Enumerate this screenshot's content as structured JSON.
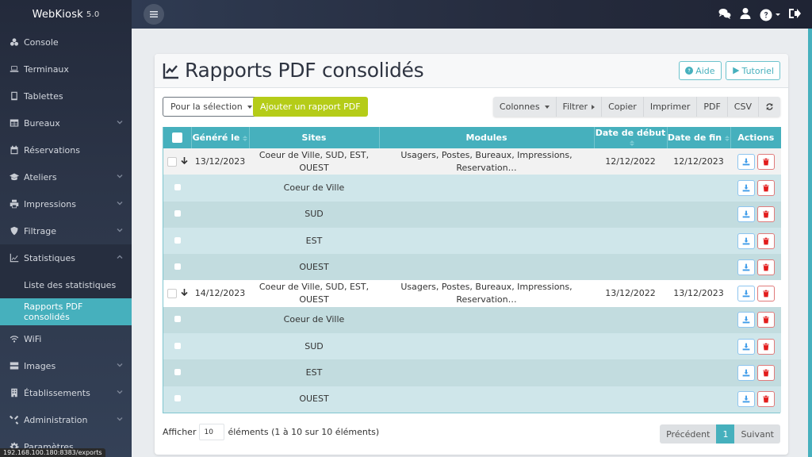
{
  "app": {
    "name": "WebKiosk",
    "version": "5.0"
  },
  "sidebar": {
    "items": [
      {
        "label": "Console",
        "icon": "cubes-icon",
        "expandable": false
      },
      {
        "label": "Terminaux",
        "icon": "laptop-icon",
        "expandable": false
      },
      {
        "label": "Tablettes",
        "icon": "tablet-icon",
        "expandable": false
      },
      {
        "label": "Bureaux",
        "icon": "table-icon",
        "expandable": true
      },
      {
        "label": "Réservations",
        "icon": "calendar-icon",
        "expandable": false
      },
      {
        "label": "Ateliers",
        "icon": "graduation-cap-icon",
        "expandable": true
      },
      {
        "label": "Impressions",
        "icon": "printer-icon",
        "expandable": true
      },
      {
        "label": "Filtrage",
        "icon": "shield-icon",
        "expandable": true
      },
      {
        "label": "Statistiques",
        "icon": "chart-line-icon",
        "expandable": true,
        "expanded": true,
        "children": [
          {
            "label": "Liste des statistiques",
            "active": false
          },
          {
            "label": "Rapports PDF consolidés",
            "active": true
          }
        ]
      },
      {
        "label": "WiFi",
        "icon": "wifi-icon",
        "expandable": false
      },
      {
        "label": "Images",
        "icon": "server-icon",
        "expandable": true
      },
      {
        "label": "Établissements",
        "icon": "building-icon",
        "expandable": true
      },
      {
        "label": "Administration",
        "icon": "tools-icon",
        "expandable": true
      },
      {
        "label": "Paramètres",
        "icon": "gear-icon",
        "expandable": false
      }
    ]
  },
  "statusbar": {
    "url": "192.168.100.180:8383/exports"
  },
  "topbar": {
    "icons": [
      "comments-icon",
      "user-icon",
      "help-icon",
      "logout-icon"
    ]
  },
  "page": {
    "title": "Rapports PDF consolidés",
    "help_label": "Aide",
    "tutorial_label": "Tutoriel"
  },
  "toolbar": {
    "selection_label": "Pour la sélection",
    "add_label": "Ajouter un rapport PDF",
    "group": [
      "Colonnes",
      "Filtrer",
      "Copier",
      "Imprimer",
      "PDF",
      "CSV"
    ]
  },
  "table": {
    "columns": [
      "Généré le",
      "Sites",
      "Modules",
      "Date de début",
      "Date de fin",
      "Actions"
    ],
    "reports": [
      {
        "generated": "13/12/2023",
        "sites_line1": "Coeur de Ville, SUD, EST,",
        "sites_line2": "OUEST",
        "modules_line1": "Usagers, Postes, Bureaux, Impressions,",
        "modules_line2": "Reservation…",
        "start": "12/12/2022",
        "end": "12/12/2023",
        "children": [
          "Coeur de Ville",
          "SUD",
          "EST",
          "OUEST"
        ]
      },
      {
        "generated": "14/12/2023",
        "sites_line1": "Coeur de Ville, SUD, EST,",
        "sites_line2": "OUEST",
        "modules_line1": "Usagers, Postes, Bureaux, Impressions,",
        "modules_line2": "Reservation…",
        "start": "13/12/2022",
        "end": "13/12/2023",
        "children": [
          "Coeur de Ville",
          "SUD",
          "EST",
          "OUEST"
        ]
      }
    ]
  },
  "footer": {
    "show_label": "Afficher",
    "page_length": "10",
    "info": "éléments (1 à 10 sur 10 éléments)",
    "prev_label": "Précédent",
    "current_page": "1",
    "next_label": "Suivant"
  },
  "colors": {
    "accent": "#46b0bd",
    "add_button": "#b5cc18",
    "delete": "#e21c1c",
    "download": "#3d9be9"
  }
}
